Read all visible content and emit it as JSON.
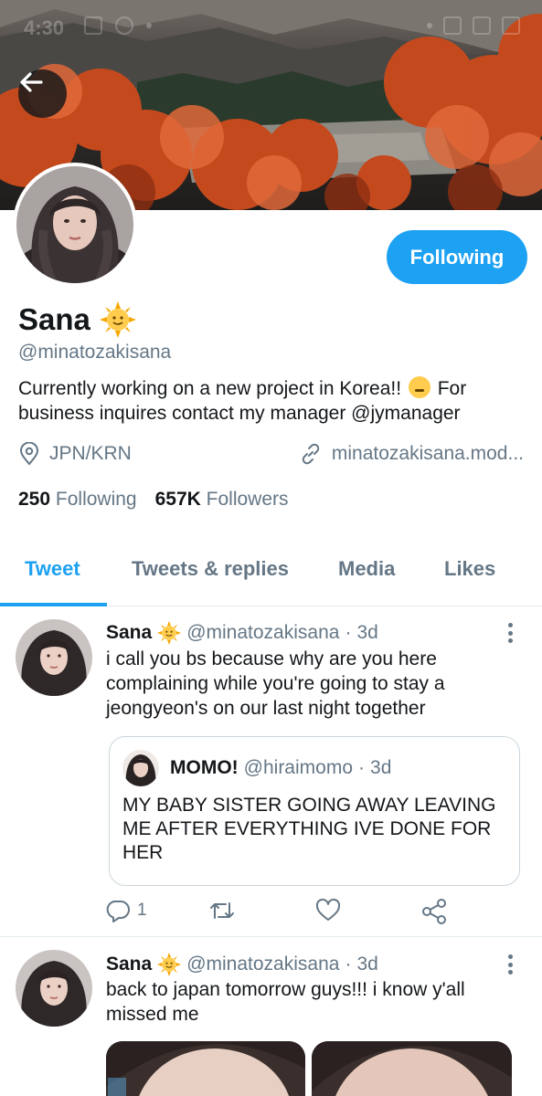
{
  "status_bar": {
    "time": "4:30"
  },
  "profile": {
    "display_name": "Sana",
    "handle": "@minatozakisana",
    "bio_part1": "Currently working on a new project in Korea!!",
    "bio_part2": "For business inquires contact my manager @jymanager",
    "location": "JPN/KRN",
    "website": "minatozakisana.mod...",
    "following_count": "250",
    "following_label": "Following",
    "followers_count": "657K",
    "followers_label": "Followers",
    "follow_button_label": "Following"
  },
  "tabs": [
    {
      "label": "Tweet",
      "active": true
    },
    {
      "label": "Tweets & replies",
      "active": false
    },
    {
      "label": "Media",
      "active": false
    },
    {
      "label": "Likes",
      "active": false
    }
  ],
  "tweets": [
    {
      "name": "Sana",
      "handle": "@minatozakisana",
      "separator": "·",
      "time": "3d",
      "text": "i call you bs because why are you here complaining while you're going to stay a jeongyeon's on our last night together",
      "quote": {
        "name": "MOMO!",
        "handle": "@hiraimomo",
        "separator": "·",
        "time": "3d",
        "text": "MY BABY SISTER GOING AWAY LEAVING ME AFTER EVERYTHING IVE DONE FOR HER"
      },
      "reply_count": "1"
    },
    {
      "name": "Sana",
      "handle": "@minatozakisana",
      "separator": "·",
      "time": "3d",
      "text": "back to japan tomorrow guys!!! i know y'all missed me"
    }
  ],
  "colors": {
    "accent": "#1da1f2",
    "muted_text": "#657786",
    "primary_text": "#14171a",
    "border": "#e6ecf0"
  },
  "icons": [
    "back-arrow-icon",
    "sun-emoji-icon",
    "shushing-face-emoji-icon",
    "location-pin-icon",
    "link-icon",
    "more-icon",
    "reply-icon",
    "retweet-icon",
    "like-icon",
    "share-icon"
  ]
}
